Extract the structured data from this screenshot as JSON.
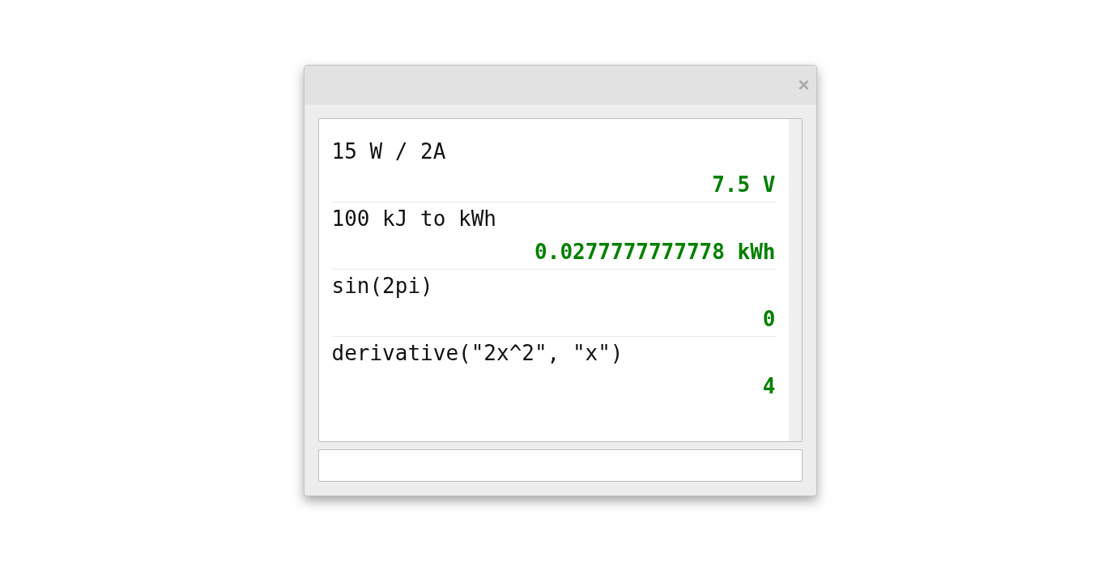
{
  "window": {
    "close_glyph": "×"
  },
  "history": [
    {
      "expression": "15 W / 2A",
      "result": "7.5 V"
    },
    {
      "expression": "100 kJ to kWh",
      "result": "0.0277777777778 kWh"
    },
    {
      "expression": "sin(2pi)",
      "result": "0"
    },
    {
      "expression": "derivative(\"2x^2\", \"x\")",
      "result": "4"
    }
  ]
}
